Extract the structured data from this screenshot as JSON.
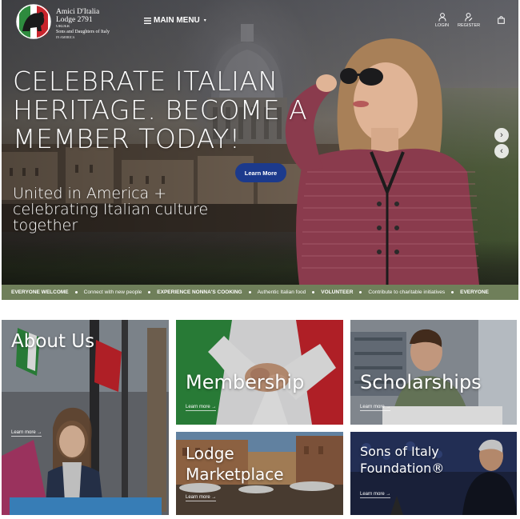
{
  "header": {
    "logo_line1": "Amici D'Italia",
    "logo_line2": "Lodge 2791",
    "logo_line3": "ORDER",
    "logo_line4": "Sons and Daughters of Italy",
    "logo_line5": "IN AMERICA",
    "main_menu": "MAIN MENU",
    "login": "LOGIN",
    "register": "REGISTER"
  },
  "hero": {
    "title": "CELEBRATE ITALIAN HERITAGE. BECOME A MEMBER TODAY!",
    "cta": "Learn More",
    "subtitle": "United in America + celebrating Italian culture together",
    "next": "›",
    "prev": "‹"
  },
  "ticker": [
    {
      "text": "EVERYONE WELCOME",
      "bold": true
    },
    {
      "text": "Connect with new people",
      "bold": false
    },
    {
      "text": "EXPERIENCE NONNA'S COOKING",
      "bold": true
    },
    {
      "text": "Authentic Italian food",
      "bold": false
    },
    {
      "text": "VOLUNTEER",
      "bold": true
    },
    {
      "text": "Contribute to charitable initiatives",
      "bold": false
    },
    {
      "text": "EVERYONE",
      "bold": true
    }
  ],
  "tiles": {
    "about": {
      "label": "About Us",
      "learn": "Learn more →"
    },
    "membership": {
      "label": "Membership",
      "learn": "Learn more →"
    },
    "scholarships": {
      "label": "Scholarships",
      "learn": "Learn more →"
    },
    "marketplace": {
      "label1": "Lodge",
      "label2": "Marketplace",
      "learn": "Learn more →"
    },
    "foundation": {
      "label1": "Sons of Italy",
      "label2": "Foundation®",
      "learn": "Learn more →"
    }
  },
  "colors": {
    "cta_blue": "#1c3a8c",
    "ticker_green": "#6f7f5a",
    "italian_green": "#2e8b3e",
    "italian_red": "#c8242c"
  }
}
